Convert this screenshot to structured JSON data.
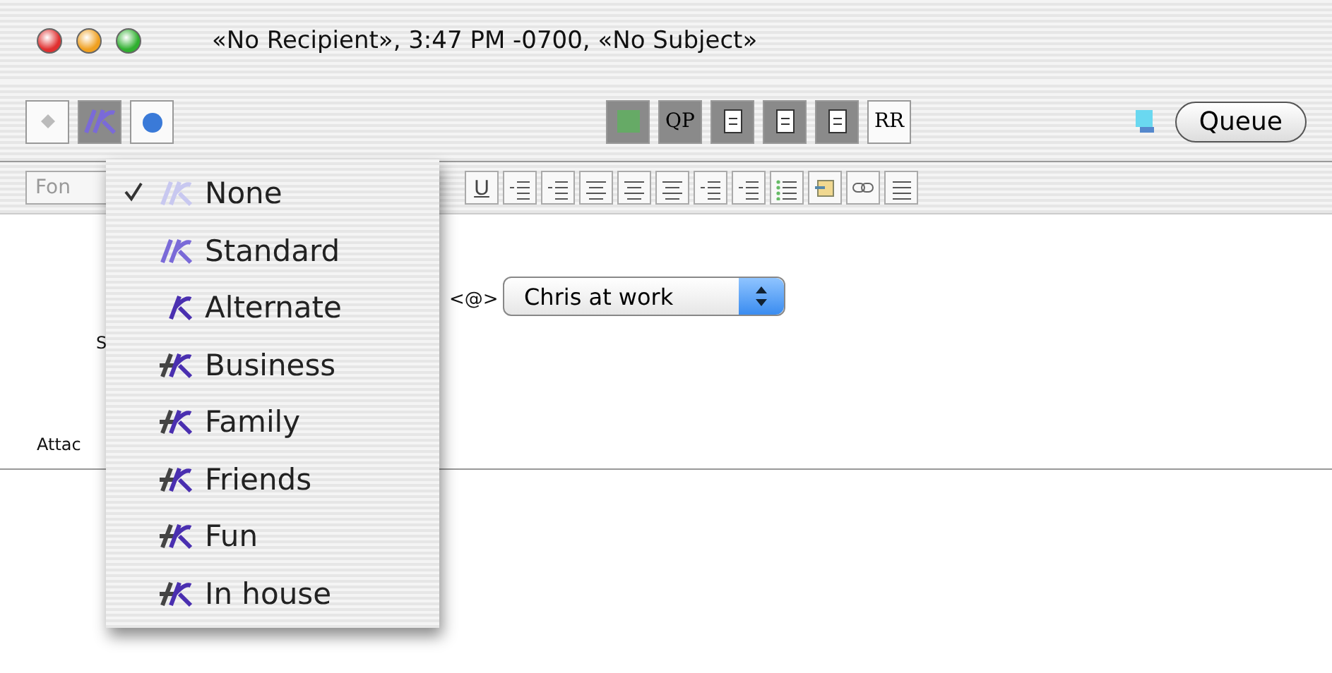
{
  "window": {
    "title": "«No Recipient», 3:47 PM -0700, «No Subject»"
  },
  "toolbar": {
    "left_buttons": [
      {
        "kind": "signature",
        "selected": false
      },
      {
        "kind": "signature",
        "selected": true
      },
      {
        "kind": "apple",
        "selected": false
      }
    ],
    "center_buttons": [
      {
        "kind": "spell"
      },
      {
        "kind": "text",
        "label": "QP"
      },
      {
        "kind": "doc"
      },
      {
        "kind": "doc"
      },
      {
        "kind": "doc"
      },
      {
        "kind": "text",
        "label": "RR"
      }
    ],
    "queue_button": "Queue"
  },
  "format_bar": {
    "font_field": "Fon",
    "underline": "U",
    "buttons": [
      {
        "kind": "indent"
      },
      {
        "kind": "indent"
      },
      {
        "kind": "align"
      },
      {
        "kind": "align"
      },
      {
        "kind": "align"
      },
      {
        "kind": "indent"
      },
      {
        "kind": "indent"
      },
      {
        "kind": "list"
      },
      {
        "kind": "attach"
      },
      {
        "kind": "link"
      },
      {
        "kind": "style"
      }
    ]
  },
  "header": {
    "address_suffix": "<@>",
    "subject_label": "S",
    "attachments_label": "Attac",
    "personality": "Chris at work"
  },
  "signature_menu": {
    "items": [
      {
        "label": "None",
        "selected": true,
        "kind": "none"
      },
      {
        "label": "Standard",
        "selected": false,
        "kind": "standard"
      },
      {
        "label": "Alternate",
        "selected": false,
        "kind": "alternate"
      },
      {
        "label": "Business",
        "selected": false,
        "kind": "custom"
      },
      {
        "label": "Family",
        "selected": false,
        "kind": "custom"
      },
      {
        "label": "Friends",
        "selected": false,
        "kind": "custom"
      },
      {
        "label": "Fun",
        "selected": false,
        "kind": "custom"
      },
      {
        "label": "In house",
        "selected": false,
        "kind": "custom"
      }
    ]
  }
}
